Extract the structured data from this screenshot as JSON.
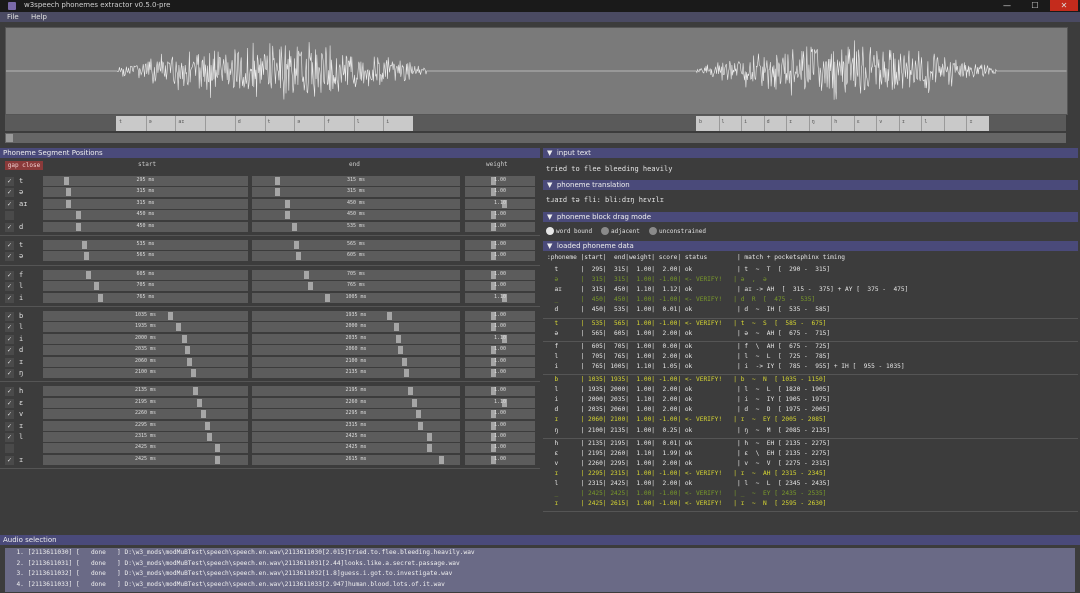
{
  "window": {
    "title": "w3speech phonemes extractor v0.5.0-pre",
    "minimize": "—",
    "maximize": "☐",
    "close": "✕"
  },
  "menu": {
    "file": "File",
    "help": "Help"
  },
  "timeline": {
    "left_block_labels": [
      "t",
      "ə",
      "aɪ",
      "",
      "d",
      "t",
      "ə",
      "f",
      "l",
      "i"
    ],
    "right_block_labels": [
      "b",
      "l",
      "i",
      "d",
      "ɪ",
      "ŋ",
      "h",
      "ɛ",
      "v",
      "ɪ",
      "l",
      "",
      "ɪ"
    ]
  },
  "segments": {
    "header": "Phoneme Segment Positions",
    "gap_button": "gap close",
    "col_start": "start",
    "col_end": "end",
    "col_weight": "weight",
    "groups": [
      [
        {
          "checked": true,
          "ph": "t",
          "start": "295 ms",
          "end": "315 ms",
          "weight": "1.00",
          "s": 0.11,
          "e": 0.12,
          "w": 0.4
        },
        {
          "checked": true,
          "ph": "ə",
          "start": "315 ms",
          "end": "315 ms",
          "weight": "1.00",
          "s": 0.12,
          "e": 0.12,
          "w": 0.4
        },
        {
          "checked": true,
          "ph": "aɪ",
          "start": "315 ms",
          "end": "450 ms",
          "weight": "1.10",
          "s": 0.12,
          "e": 0.17,
          "w": 0.55
        },
        {
          "checked": false,
          "ph": "",
          "start": "450 ms",
          "end": "450 ms",
          "weight": "1.00",
          "s": 0.17,
          "e": 0.17,
          "w": 0.4
        },
        {
          "checked": true,
          "ph": "d",
          "start": "450 ms",
          "end": "535 ms",
          "weight": "1.00",
          "s": 0.17,
          "e": 0.2,
          "w": 0.4
        }
      ],
      [
        {
          "checked": true,
          "ph": "t",
          "start": "535 ms",
          "end": "565 ms",
          "weight": "1.00",
          "s": 0.2,
          "e": 0.21,
          "w": 0.4
        },
        {
          "checked": true,
          "ph": "ə",
          "start": "565 ms",
          "end": "605 ms",
          "weight": "1.00",
          "s": 0.21,
          "e": 0.22,
          "w": 0.4
        }
      ],
      [
        {
          "checked": true,
          "ph": "f",
          "start": "605 ms",
          "end": "705 ms",
          "weight": "1.00",
          "s": 0.22,
          "e": 0.26,
          "w": 0.4
        },
        {
          "checked": true,
          "ph": "l",
          "start": "705 ms",
          "end": "765 ms",
          "weight": "1.00",
          "s": 0.26,
          "e": 0.28,
          "w": 0.4
        },
        {
          "checked": true,
          "ph": "i",
          "start": "765 ms",
          "end": "1005 ms",
          "weight": "1.10",
          "s": 0.28,
          "e": 0.36,
          "w": 0.55
        }
      ],
      [
        {
          "checked": true,
          "ph": "b",
          "start": "1035 ms",
          "end": "1935 ms",
          "weight": "1.00",
          "s": 0.62,
          "e": 0.66,
          "w": 0.4
        },
        {
          "checked": true,
          "ph": "l",
          "start": "1935 ms",
          "end": "2000 ms",
          "weight": "1.00",
          "s": 0.66,
          "e": 0.69,
          "w": 0.4
        },
        {
          "checked": true,
          "ph": "i",
          "start": "2000 ms",
          "end": "2035 ms",
          "weight": "1.10",
          "s": 0.69,
          "e": 0.7,
          "w": 0.55
        },
        {
          "checked": true,
          "ph": "d",
          "start": "2035 ms",
          "end": "2060 ms",
          "weight": "1.00",
          "s": 0.7,
          "e": 0.71,
          "w": 0.4
        },
        {
          "checked": true,
          "ph": "ɪ",
          "start": "2060 ms",
          "end": "2100 ms",
          "weight": "1.00",
          "s": 0.71,
          "e": 0.73,
          "w": 0.4
        },
        {
          "checked": true,
          "ph": "ŋ",
          "start": "2100 ms",
          "end": "2135 ms",
          "weight": "1.00",
          "s": 0.73,
          "e": 0.74,
          "w": 0.4
        }
      ],
      [
        {
          "checked": true,
          "ph": "h",
          "start": "2135 ms",
          "end": "2195 ms",
          "weight": "1.00",
          "s": 0.74,
          "e": 0.76,
          "w": 0.4
        },
        {
          "checked": true,
          "ph": "ɛ",
          "start": "2195 ms",
          "end": "2260 ms",
          "weight": "1.10",
          "s": 0.76,
          "e": 0.78,
          "w": 0.55
        },
        {
          "checked": true,
          "ph": "v",
          "start": "2260 ms",
          "end": "2295 ms",
          "weight": "1.00",
          "s": 0.78,
          "e": 0.8,
          "w": 0.4
        },
        {
          "checked": true,
          "ph": "ɪ",
          "start": "2295 ms",
          "end": "2315 ms",
          "weight": "1.00",
          "s": 0.8,
          "e": 0.81,
          "w": 0.4
        },
        {
          "checked": true,
          "ph": "l",
          "start": "2315 ms",
          "end": "2425 ms",
          "weight": "1.00",
          "s": 0.81,
          "e": 0.85,
          "w": 0.4
        },
        {
          "checked": false,
          "ph": "",
          "start": "2425 ms",
          "end": "2425 ms",
          "weight": "1.00",
          "s": 0.85,
          "e": 0.85,
          "w": 0.4
        },
        {
          "checked": true,
          "ph": "ɪ",
          "start": "2425 ms",
          "end": "2615 ms",
          "weight": "1.00",
          "s": 0.85,
          "e": 0.91,
          "w": 0.4
        }
      ]
    ]
  },
  "input_text": {
    "header": "input text",
    "value": "tried to flee bleeding heavily"
  },
  "translation": {
    "header": "phoneme translation",
    "value": "tɹaɪd tə fli: bli:dɪŋ hɛvɪlɪ"
  },
  "drag_mode": {
    "header": "phoneme block drag mode",
    "options": [
      "word bound",
      "adjacent",
      "unconstrained"
    ],
    "selected": 0
  },
  "loaded": {
    "header": "loaded phoneme data",
    "colheader": ":phoneme |start|  end|weight| score| status        | match + pocketsphinx timing",
    "colors": {
      "ok": "#e6e6e6",
      "verify": "#d8d832",
      "dim": "#7a9a2a"
    },
    "groups": [
      [
        {
          "t": "  t      |  295|  315|  1.00|  2.00| ok            | t  ~  T  [  290 -  315]",
          "c": "ok"
        },
        {
          "t": "  ə      |  315|  315|  1.00| -1.00| <- VERIFY!   | ə  ,  ə",
          "c": "dim"
        },
        {
          "t": "  aɪ     |  315|  450|  1.10|  1.12| ok            | aɪ -> AH  [  315 -  375] + AY [  375 -  475]",
          "c": "ok"
        },
        {
          "t": "  _      |  450|  450|  1.00| -1.00| <- VERIFY!   | d  R  [  475 -  535]",
          "c": "dim"
        },
        {
          "t": "  d      |  450|  535|  1.00|  0.01| ok            | d  ~  IH [  535 -  585]",
          "c": "ok"
        }
      ],
      [
        {
          "t": "  t      |  535|  565|  1.00| -1.00| <- VERIFY!   | t  ~  S  [  585 -  675]",
          "c": "verify"
        },
        {
          "t": "  ə      |  565|  605|  1.00|  2.00| ok            | ə  ~  AH [  675 -  715]",
          "c": "ok"
        }
      ],
      [
        {
          "t": "  f      |  605|  705|  1.00|  0.00| ok            | f  \\  AH [  675 -  725]",
          "c": "ok"
        },
        {
          "t": "  l      |  705|  765|  1.00|  2.00| ok            | l  ~  L  [  725 -  785]",
          "c": "ok"
        },
        {
          "t": "  i      |  765| 1005|  1.10|  1.05| ok            | i  -> IY [  785 -  955] + IH [  955 - 1035]",
          "c": "ok"
        }
      ],
      [
        {
          "t": "  b      | 1035| 1935|  1.00| -1.00| <- VERIFY!   | b  ~  N  [ 1035 - 1150]",
          "c": "verify"
        },
        {
          "t": "  l      | 1935| 2000|  1.00|  2.00| ok            | l  ~  L  [ 1820 - 1905]",
          "c": "ok"
        },
        {
          "t": "  i      | 2000| 2035|  1.10|  2.00| ok            | i  ~  IY [ 1905 - 1975]",
          "c": "ok"
        },
        {
          "t": "  d      | 2035| 2060|  1.00|  2.00| ok            | d  ~  D  [ 1975 - 2005]",
          "c": "ok"
        },
        {
          "t": "  ɪ      | 2060| 2100|  1.00| -1.00| <- VERIFY!   | ɪ  ~  EY [ 2005 - 2085]",
          "c": "verify"
        },
        {
          "t": "  ŋ      | 2100| 2135|  1.00|  0.25| ok            | ŋ  ~  M  [ 2085 - 2135]",
          "c": "ok"
        }
      ],
      [
        {
          "t": "  h      | 2135| 2195|  1.00|  0.01| ok            | h  ~  EH [ 2135 - 2275]",
          "c": "ok"
        },
        {
          "t": "  ɛ      | 2195| 2260|  1.10|  1.99| ok            | ɛ  \\  EH [ 2135 - 2275]",
          "c": "ok"
        },
        {
          "t": "  v      | 2260| 2295|  1.00|  2.00| ok            | v  ~  V  [ 2275 - 2315]",
          "c": "ok"
        },
        {
          "t": "  ɪ      | 2295| 2315|  1.00| -1.00| <- VERIFY!   | ɪ  ~  AH [ 2315 - 2345]",
          "c": "verify"
        },
        {
          "t": "  l      | 2315| 2425|  1.00|  2.00| ok            | l  ~  L  [ 2345 - 2435]",
          "c": "ok"
        },
        {
          "t": "  _      | 2425| 2425|  1.00| -1.00| <- VERIFY!   | _  ~  EY [ 2435 - 2535]",
          "c": "dim"
        },
        {
          "t": "  ɪ      | 2425| 2615|  1.00| -1.00| <- VERIFY!   | ɪ  ~  N  [ 2595 - 2630]",
          "c": "verify"
        }
      ]
    ]
  },
  "audio": {
    "header": "Audio selection",
    "rows": [
      "  1. [2113611030] [   done   ] D:\\w3_mods\\modMuBTest\\speech\\speech.en.wav\\2113611030[2.015]tried.to.flee.bleeding.heavily.wav",
      "  2. [2113611031] [   done   ] D:\\w3_mods\\modMuBTest\\speech\\speech.en.wav\\2113611031[2.44]looks.like.a.secret.passage.wav",
      "  3. [2113611032] [   done   ] D:\\w3_mods\\modMuBTest\\speech\\speech.en.wav\\2113611032[1.8]guess.i.got.to.investigate.wav",
      "  4. [2113611033] [   done   ] D:\\w3_mods\\modMuBTest\\speech\\speech.en.wav\\2113611033[2.947]human.blood.lots.of.it.wav"
    ]
  }
}
